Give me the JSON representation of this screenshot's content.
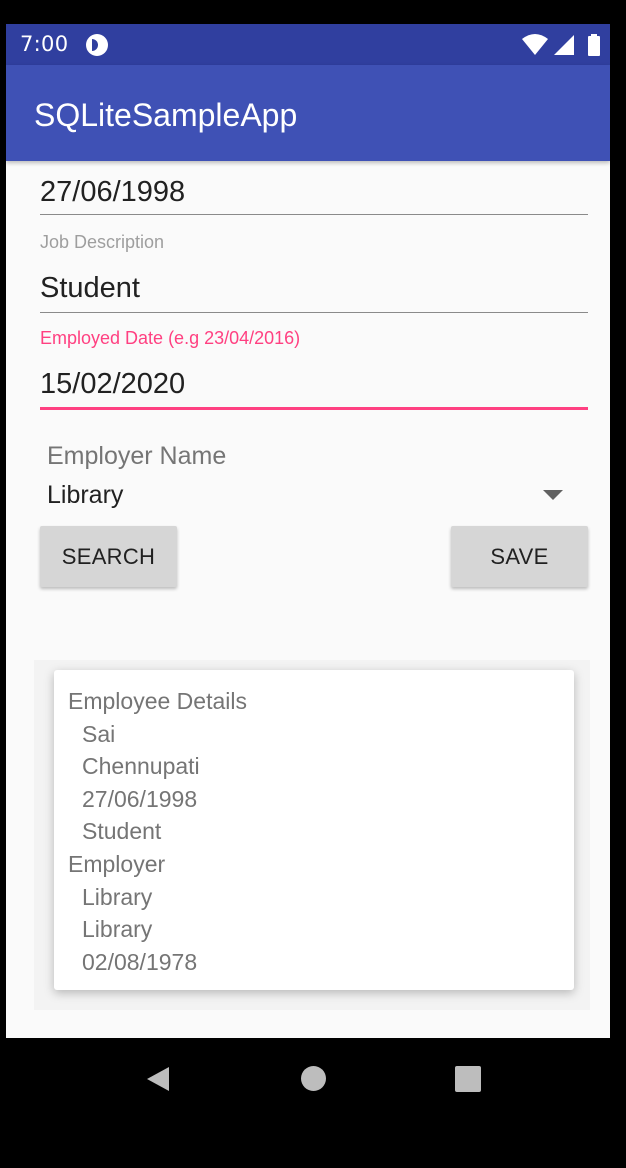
{
  "status_bar": {
    "time": "7:00",
    "icons": [
      "app-notification-icon",
      "wifi-icon",
      "signal-icon",
      "battery-icon"
    ]
  },
  "app_bar": {
    "title": "SQLiteSampleApp"
  },
  "form": {
    "birth_date_value": "27/06/1998",
    "job_description_label": "Job Description",
    "job_description_value": "Student",
    "employed_date_label": "Employed Date (e.g 23/04/2016)",
    "employed_date_value": "15/02/2020",
    "employer_label": "Employer Name",
    "employer_value": "Library"
  },
  "buttons": {
    "search": "SEARCH",
    "save": "SAVE"
  },
  "details": {
    "employee_heading": "Employee Details",
    "first_name": "Sai",
    "last_name": "Chennupati",
    "birth_date": "27/06/1998",
    "job": "Student",
    "employer_heading": "Employer",
    "employer_name": "Library",
    "employer_description": "Library",
    "employer_date": "02/08/1978"
  },
  "nav_bar": {
    "icons": [
      "back-icon",
      "home-icon",
      "recents-icon"
    ]
  },
  "colors": {
    "primary_dark": "#303f9f",
    "primary": "#3f51b5",
    "accent": "#ff4081",
    "button": "#d6d6d6"
  }
}
